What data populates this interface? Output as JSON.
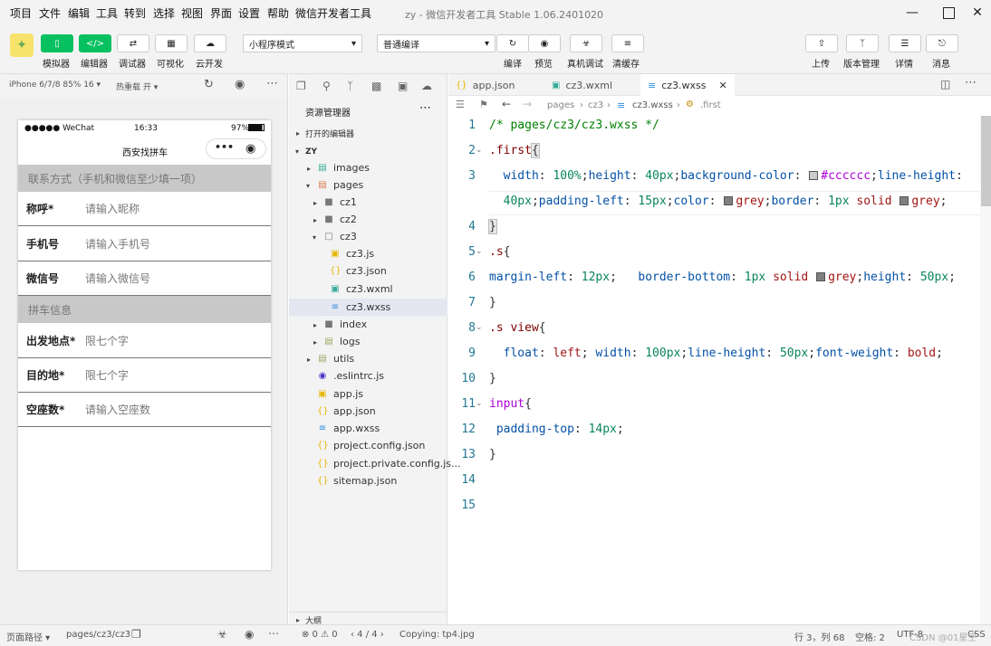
{
  "menu": [
    "项目",
    "文件",
    "编辑",
    "工具",
    "转到",
    "选择",
    "视图",
    "界面",
    "设置",
    "帮助",
    "微信开发者工具"
  ],
  "window_title": "zy - 微信开发者工具 Stable 1.06.2401020",
  "toolbar": {
    "left_labels": [
      "模拟器",
      "编辑器",
      "调试器",
      "可视化",
      "云开发"
    ],
    "mode_select": "小程序模式",
    "compile_select": "普通编译",
    "mid_labels": [
      "编译",
      "预览",
      "真机调试",
      "清缓存"
    ],
    "right_labels": [
      "上传",
      "版本管理",
      "详情",
      "消息"
    ]
  },
  "sim": {
    "device": "iPhone 6/7/8 85% 16 ▾",
    "hotreload": "热重载 开 ▾"
  },
  "phone": {
    "carrier": "●●●●● WeChat",
    "time": "16:33",
    "battery": "97%",
    "nav_title": "西安找拼车",
    "section1": "联系方式（手机和微信至少填一项）",
    "section2": "拼车信息",
    "fields1": [
      {
        "label": "称呼*",
        "placeholder": "请输入昵称"
      },
      {
        "label": "手机号",
        "placeholder": "请输入手机号"
      },
      {
        "label": "微信号",
        "placeholder": "请输入微信号"
      }
    ],
    "fields2": [
      {
        "label": "出发地点*",
        "placeholder": "限七个字"
      },
      {
        "label": "目的地*",
        "placeholder": "限七个字"
      },
      {
        "label": "空座数*",
        "placeholder": "请输入空座数"
      }
    ]
  },
  "explorer": {
    "title": "资源管理器",
    "open_editors": "打开的编辑器",
    "root": "ZY",
    "tree": [
      "images",
      "pages",
      "cz1",
      "cz2",
      "cz3",
      "cz3.js",
      "cz3.json",
      "cz3.wxml",
      "cz3.wxss",
      "index",
      "logs",
      "utils",
      ".eslintrc.js",
      "app.js",
      "app.json",
      "app.wxss",
      "project.config.json",
      "project.private.config.js...",
      "sitemap.json"
    ],
    "outline": "大纲"
  },
  "tabs": [
    "app.json",
    "cz3.wxml",
    "cz3.wxss"
  ],
  "breadcrumb": [
    "pages",
    "cz3",
    "cz3.wxss",
    ".first"
  ],
  "line_numbers": [
    "1",
    "2",
    "3",
    "",
    "4",
    "5",
    "6",
    "7",
    "8",
    "9",
    "10",
    "11",
    "12",
    "13",
    "14",
    "15"
  ],
  "status": {
    "path_label": "页面路径 ▾",
    "path": "pages/cz3/cz3",
    "errors": "⊗ 0 ⚠ 0",
    "nav": "‹ 4 / 4 ›",
    "copying": "Copying: tp4.jpg",
    "position": "行 3，列 68",
    "spaces": "空格: 2",
    "encoding": "UTF-8",
    "lang": "CSS",
    "watermark": "CSDN @01星空"
  },
  "colors": {
    "brand_green": "#07c160",
    "selection": "#e4e6f1"
  }
}
